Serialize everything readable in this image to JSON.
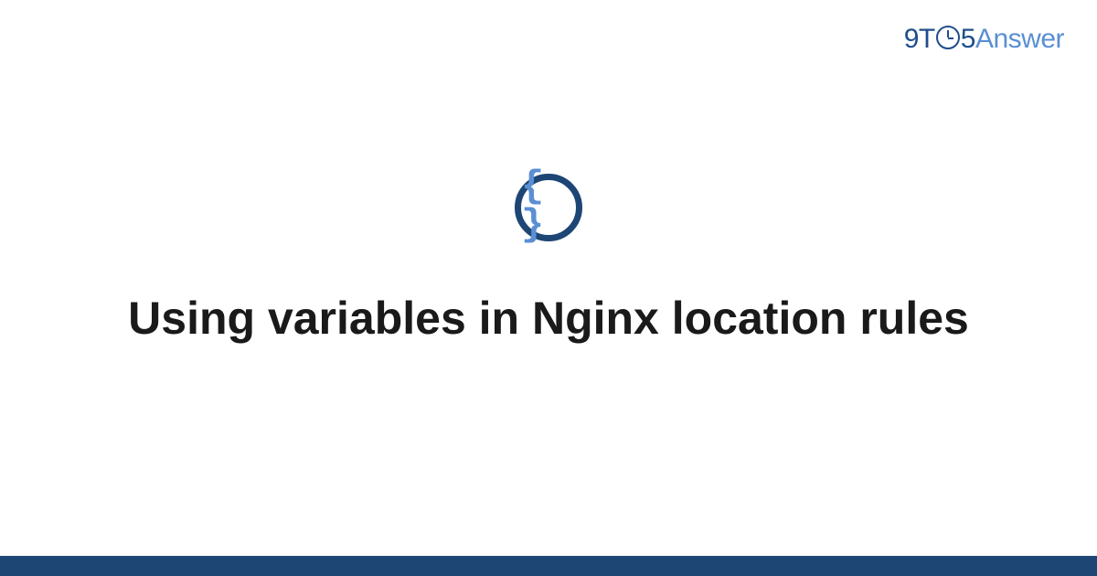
{
  "logo": {
    "prefix": "9T",
    "suffix": "5",
    "answer": "Answer"
  },
  "icon": {
    "braces": "{ }"
  },
  "title": "Using variables in Nginx location rules"
}
